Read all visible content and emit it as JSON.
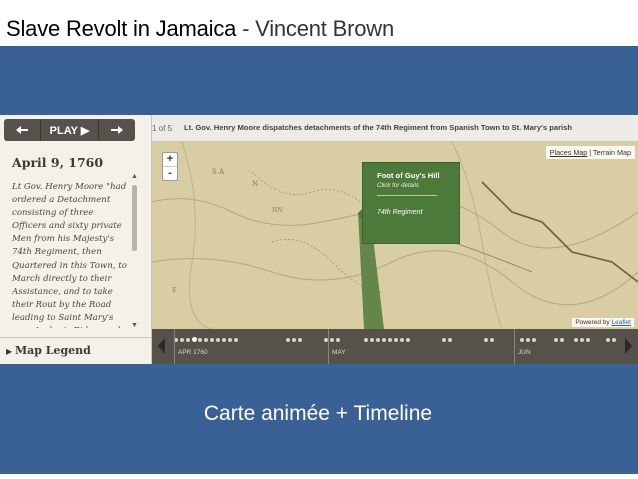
{
  "slide": {
    "title": "Slave Revolt in Jamaica",
    "author": " - Vincent Brown",
    "subtitle": "Carte animée + Timeline"
  },
  "player": {
    "play_label": "PLAY ▶",
    "prev_icon": "left-arrow-icon",
    "next_icon": "right-arrow-icon"
  },
  "story": {
    "counter": "1 of 5",
    "caption": "Lt. Gov. Henry Moore dispatches detachments of the 74th Regiment from Spanish Town to St. Mary's parish",
    "date": "April 9, 1760",
    "text": "Lt Gov. Henry Moore \"had ordered a Detachment consisting of three Officers and sixty private Men from his Majesty's 74th Regiment, then Quartered in this Town, to March directly to their Assistance, and to take their Rout by the Road leading to Saint Mary's over Archer's Ridge, and that another Detachment of the same"
  },
  "legend": {
    "label": "Map Legend",
    "icon": "triangle-right-icon"
  },
  "map": {
    "layers": [
      "Places Map",
      "Terrain Map"
    ],
    "selected_layer": "Places Map",
    "separator": " | ",
    "zoom_in": "+",
    "zoom_out": "-",
    "popup": {
      "title": "Foot of Guy's Hill",
      "subtitle": "Click for details",
      "unit": "74th Regiment"
    },
    "attribution": "Powered by",
    "attribution_link": "Leaflet"
  },
  "timeline": {
    "months": [
      "APR 1760",
      "MAY",
      "JUN"
    ]
  },
  "colors": {
    "slide_bg": "#3a6196",
    "popup_green": "#4d7a3a",
    "panel_dark": "#56524b"
  }
}
